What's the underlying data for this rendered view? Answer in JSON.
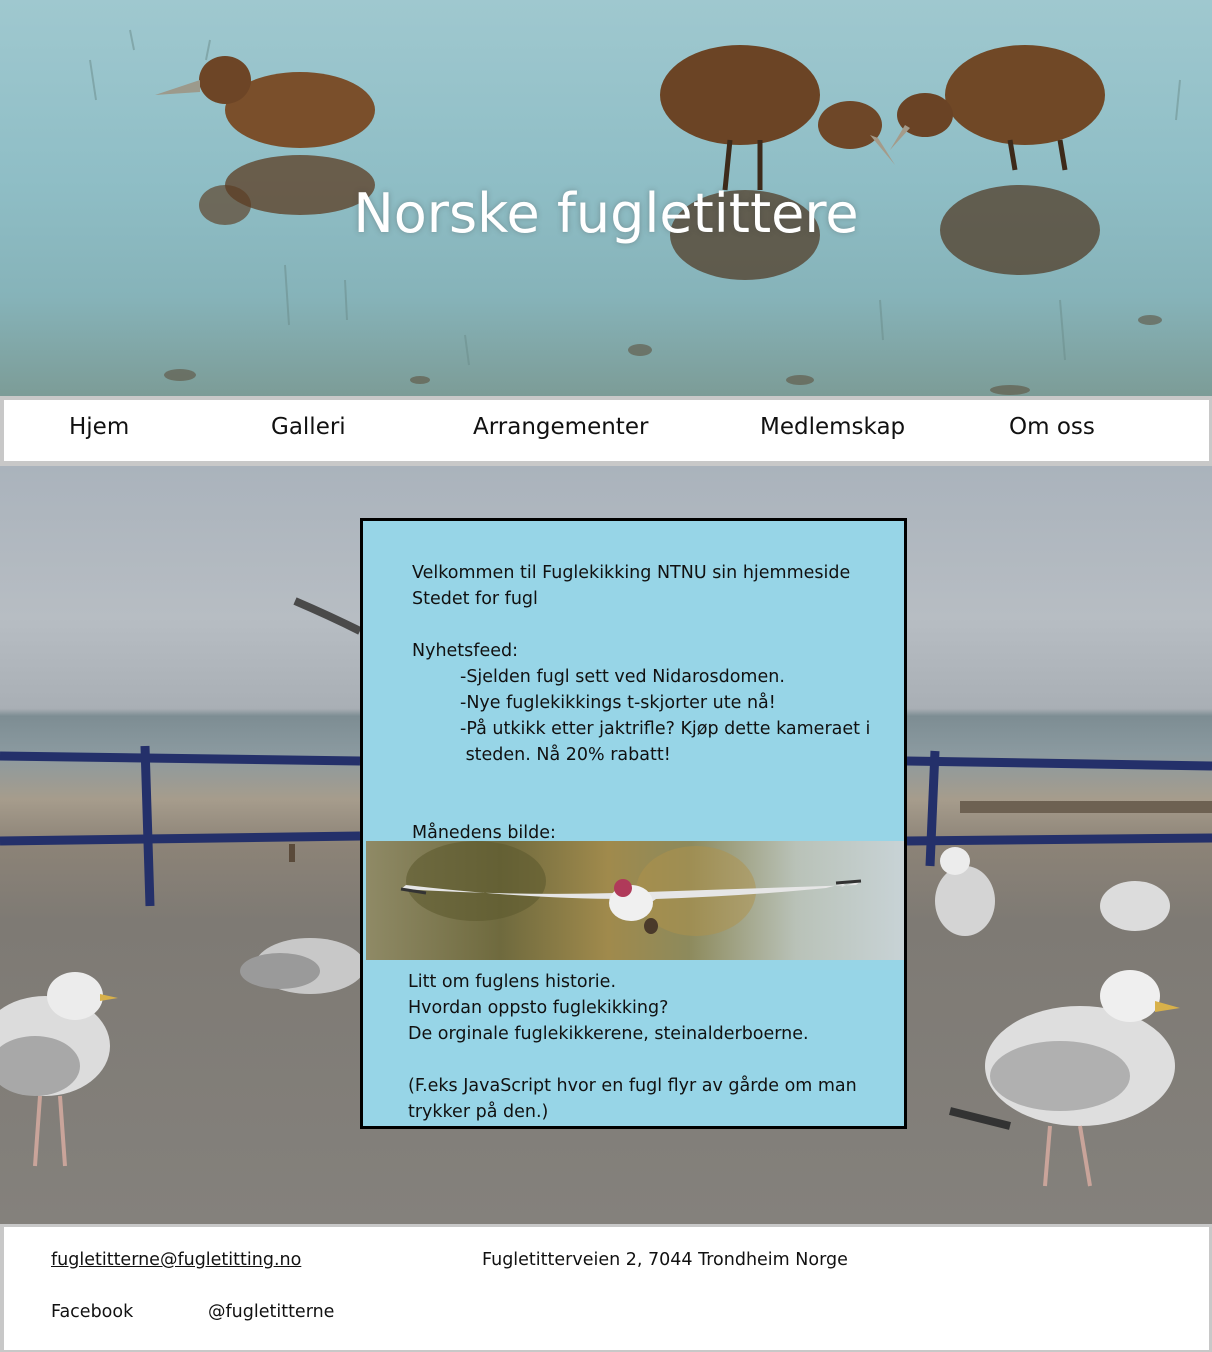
{
  "header": {
    "title": "Norske fugletittere",
    "image_icon": "ducklings-image"
  },
  "nav": {
    "items": [
      {
        "label": "Hjem"
      },
      {
        "label": "Galleri"
      },
      {
        "label": "Arrangementer"
      },
      {
        "label": "Medlemskap"
      },
      {
        "label": "Om oss"
      }
    ]
  },
  "background": {
    "image_icon": "seagulls-beach-image"
  },
  "content": {
    "welcome": "Velkommen til Fuglekikking NTNU sin hjemmeside",
    "tagline": "Stedet for fugl",
    "news_heading": "Nyhetsfeed:",
    "news": [
      "-Sjelden fugl sett ved Nidarosdomen.",
      "-Nye fuglekikkings t-skjorter ute nå!",
      "-På utkikk etter jaktrifle? Kjøp dette kameraet i",
      " steden. Nå 20% rabatt!"
    ],
    "photo_heading": "Månedens bilde:",
    "photo_icon": "flying-bird-image",
    "history": [
      "Litt om fuglens historie.",
      "Hvordan oppsto fuglekikking?",
      "De orginale fuglekikkerene, steinalderboerne."
    ],
    "note": [
      "(F.eks JavaScript hvor en fugl flyr av gårde om man",
      "trykker på den.)"
    ]
  },
  "footer": {
    "email": "fugletitterne@fugletitting.no",
    "address": "Fugletitterveien 2, 7044 Trondheim Norge",
    "social_label": "Facebook",
    "social_handle": "@fugletitterne"
  },
  "colors": {
    "card_background": "#97d5e7",
    "card_border": "#000000",
    "nav_background": "#ffffff",
    "frame_gray": "#c8c8c8"
  }
}
